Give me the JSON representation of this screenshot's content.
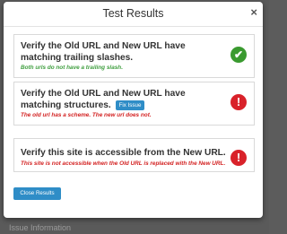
{
  "modal": {
    "title": "Test Results",
    "close_symbol": "×",
    "close_results_label": "Close Results"
  },
  "results": [
    {
      "title": "Verify the Old URL and New URL have matching trailing slashes.",
      "message": "Both urls do not have a trailing slash.",
      "status": "pass",
      "icon": "check-circle-icon",
      "icon_glyph": "✔"
    },
    {
      "title": "Verify the Old URL and New URL have matching structures.",
      "fix_label": "Fix Issue",
      "message": "The old url has a scheme. The new url does not.",
      "status": "fail",
      "icon": "exclamation-circle-icon",
      "icon_glyph": "!"
    },
    {
      "title": "Verify this site is accessible from the New URL.",
      "message": "This site is not accessible when the Old URL is replaced with the New URL.",
      "status": "fail",
      "icon": "exclamation-circle-icon",
      "icon_glyph": "!"
    }
  ],
  "background_text": "Issue Information",
  "colors": {
    "pass": "#3a9a2f",
    "fail": "#d9222a",
    "button": "#2f8dc7"
  }
}
